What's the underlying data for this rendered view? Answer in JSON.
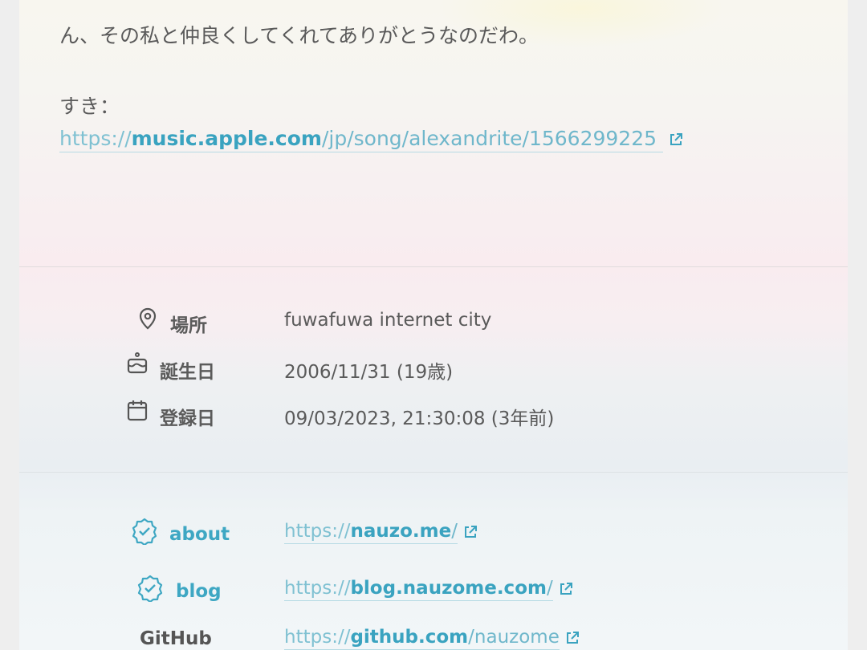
{
  "bio": {
    "line1": "ん、その私と仲良くしてくれてありがとうなのだわ。",
    "like_label": "すき：",
    "url": {
      "scheme": "https://",
      "host": "music.apple.com",
      "path": "/jp/song/alexandrite/1566299225"
    }
  },
  "info": [
    {
      "icon": "location-pin-icon",
      "label": "場所",
      "value": "fuwafuwa internet city"
    },
    {
      "icon": "birthday-cake-icon",
      "label": "誕生日",
      "value": "2006/11/31 (19歳)"
    },
    {
      "icon": "calendar-icon",
      "label": "登録日",
      "value": "09/03/2023, 21:30:08 (3年前)"
    }
  ],
  "fields": [
    {
      "icon": "verified-badge-icon",
      "label": "about",
      "scheme": "https://",
      "host": "nauzo.me",
      "path": "/"
    },
    {
      "icon": "verified-badge-icon",
      "label": "blog",
      "scheme": "https://",
      "host": "blog.nauzome.com",
      "path": "/"
    },
    {
      "icon": "",
      "label": "GitHub",
      "scheme": "https://",
      "host": "github.com",
      "path": "/nauzome"
    }
  ],
  "colors": {
    "accent": "#3aa3c0",
    "text": "#5a5a5a"
  }
}
